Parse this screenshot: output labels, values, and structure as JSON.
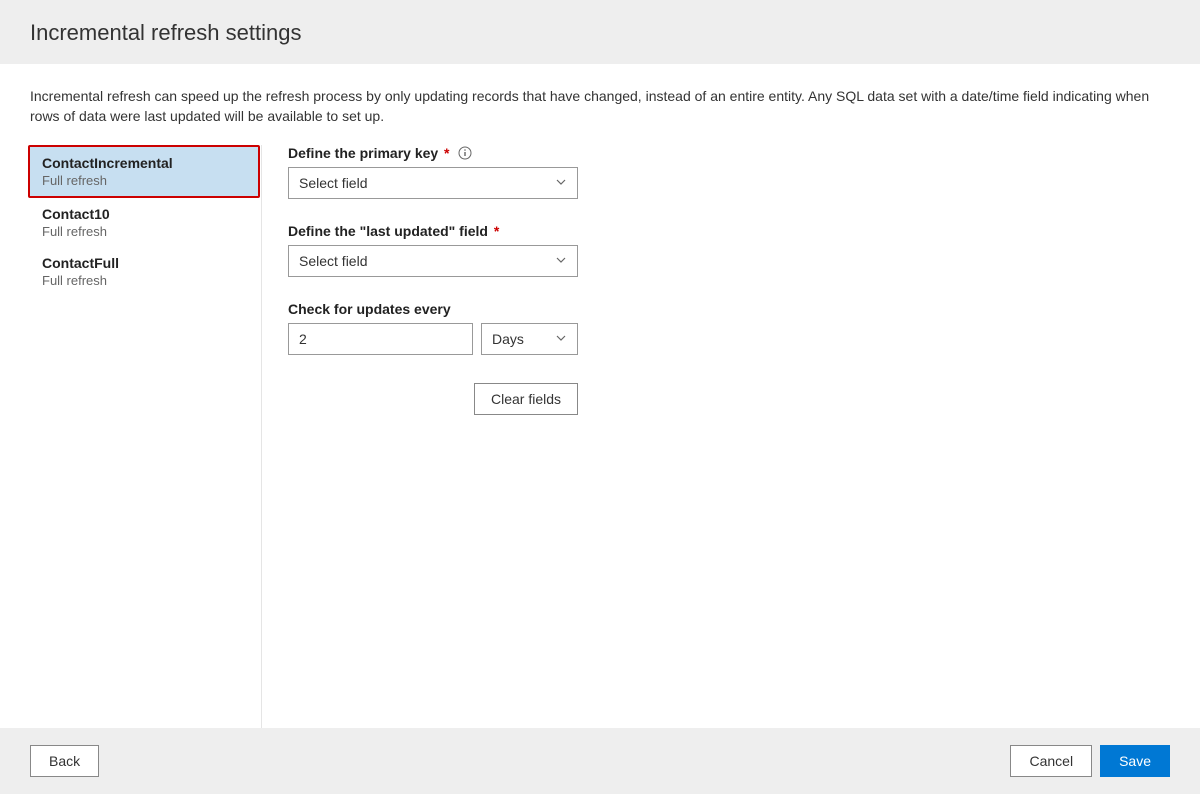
{
  "page": {
    "title": "Incremental refresh settings",
    "description": "Incremental refresh can speed up the refresh process by only updating records that have changed, instead of an entire entity. Any SQL data set with a date/time field indicating when rows of data were last updated will be available to set up."
  },
  "entities": [
    {
      "name": "ContactIncremental",
      "sub": "Full refresh",
      "selected": true
    },
    {
      "name": "Contact10",
      "sub": "Full refresh",
      "selected": false
    },
    {
      "name": "ContactFull",
      "sub": "Full refresh",
      "selected": false
    }
  ],
  "form": {
    "primary_key_label": "Define the primary key",
    "primary_key_value": "Select field",
    "last_updated_label": "Define the \"last updated\" field",
    "last_updated_value": "Select field",
    "check_label": "Check for updates every",
    "check_value": "2",
    "check_unit": "Days",
    "clear_label": "Clear fields"
  },
  "footer": {
    "back": "Back",
    "cancel": "Cancel",
    "save": "Save"
  }
}
